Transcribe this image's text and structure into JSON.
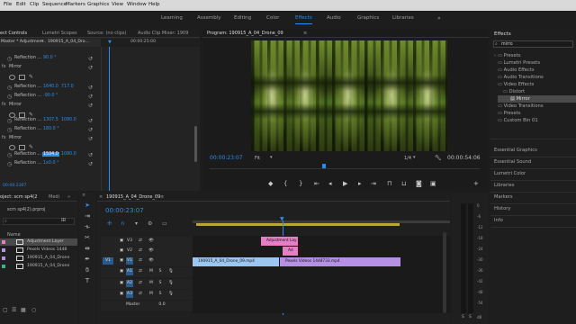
{
  "menubar": {
    "items": [
      "File",
      "Edit",
      "Clip",
      "Sequence",
      "Markers",
      "Graphics",
      "View",
      "Window",
      "Help"
    ]
  },
  "workspaces": {
    "items": [
      "Learning",
      "Assembly",
      "Editing",
      "Color",
      "Effects",
      "Audio",
      "Graphics",
      "Libraries"
    ],
    "active": "Effects"
  },
  "effect_controls": {
    "tabs": [
      "ect Controls",
      "Lumetri Scopes",
      "Source: (no clips)",
      "Audio Clip Mixer: 1909"
    ],
    "clip_path": "Master * Adjustmen...",
    "sequence": "190915_A_04_Dro...",
    "ruler_time": "00:00:25:00",
    "rows": [
      {
        "label": "Reflection ...",
        "value": "90.0 °"
      },
      {
        "label": "Mirror",
        "value": ""
      },
      {
        "label": "Reflection ...",
        "value": "1640.0",
        "value2": "717.0"
      },
      {
        "label": "Reflection ...",
        "value": "-90.0 °"
      },
      {
        "label": "Mirror",
        "value": ""
      },
      {
        "label": "Reflection ...",
        "value": "1307.5",
        "value2": "1080.0"
      },
      {
        "label": "Reflection ...",
        "value": "180.0 °"
      },
      {
        "label": "Mirror",
        "value": ""
      },
      {
        "label": "Reflection ...",
        "value": "1504.0",
        "value2": "1080.0"
      },
      {
        "label": "Reflection ...",
        "value": "1x0.0 °"
      }
    ],
    "timecode": "00:00:2307"
  },
  "program": {
    "title": "Program: 190915_A_04_Drone_09",
    "timecode": "00:00:23:07",
    "fit": "Fit",
    "resolution": "1/4",
    "duration": "00:00:54:06"
  },
  "effects_panel": {
    "title": "Effects",
    "search_value": "mirro",
    "tree": [
      {
        "label": "Presets",
        "level": 0,
        "icon": "folder"
      },
      {
        "label": "Lumetri Presets",
        "level": 0,
        "icon": "folder"
      },
      {
        "label": "Audio Effects",
        "level": 0,
        "icon": "folder"
      },
      {
        "label": "Audio Transitions",
        "level": 0,
        "icon": "folder"
      },
      {
        "label": "Video Effects",
        "level": 0,
        "icon": "folder"
      },
      {
        "label": "Distort",
        "level": 1,
        "icon": "folder"
      },
      {
        "label": "Mirror",
        "level": 2,
        "icon": "effect",
        "selected": true
      },
      {
        "label": "Video Transitions",
        "level": 0,
        "icon": "folder"
      },
      {
        "label": "Presets",
        "level": 0,
        "icon": "folder"
      },
      {
        "label": "Custom Bin 01",
        "level": 0,
        "icon": "folder"
      }
    ],
    "sections": [
      "Essential Graphics",
      "Essential Sound",
      "Lumetri Color",
      "Libraries",
      "Markers",
      "History",
      "Info"
    ]
  },
  "project": {
    "tabs": [
      "oject: scm sp4(2",
      "Medi"
    ],
    "file": "scm sp4(2).prproj",
    "name_header": "Name",
    "items": [
      {
        "name": "Adjustment Layer",
        "color": "#e47fc6"
      },
      {
        "name": "Pexels Videos 1448",
        "color": "#b690e4"
      },
      {
        "name": "190915_A_04_Drone",
        "color": "#b690e4"
      },
      {
        "name": "190915_A_04_Drone",
        "color": "#3fb08f"
      }
    ]
  },
  "timeline": {
    "title": "190915_A_04_Drone_09",
    "timecode": "00:00:23:07",
    "ruler_labels": [
      "00:00:15:00",
      "00:00:30:00",
      "00:00:45:00"
    ],
    "tracks": [
      {
        "name": "V3",
        "type": "video"
      },
      {
        "name": "V2",
        "type": "video"
      },
      {
        "name": "V1",
        "type": "video",
        "source": "V1"
      },
      {
        "name": "A1",
        "type": "audio",
        "source": "A1"
      },
      {
        "name": "A2",
        "type": "audio"
      },
      {
        "name": "A3",
        "type": "audio"
      }
    ],
    "master_label": "Master",
    "master_value": "0.0",
    "clips": [
      {
        "label": "Adjustment Lay",
        "track": "V3",
        "color": "#e47fc6"
      },
      {
        "label": "Ad",
        "track": "V2",
        "color": "#e47fc6"
      },
      {
        "label": "190915_A_04_Drone_09.mp4",
        "track": "V1",
        "color": "#9bc6f0"
      },
      {
        "label": "Pexels Videos 1448733.mp4",
        "track": "V1",
        "color": "#b690e4"
      }
    ]
  },
  "audio_meter": {
    "labels": [
      "0",
      "-6",
      "-12",
      "-18",
      "-24",
      "-30",
      "-36",
      "-42",
      "-48",
      "-54",
      "dB"
    ],
    "solo": "S"
  },
  "colors": {
    "accent": "#2d8ceb",
    "playhead": "#2d8ceb",
    "adjustment": "#e47fc6",
    "pexels": "#b690e4",
    "drone": "#9bc6f0"
  }
}
